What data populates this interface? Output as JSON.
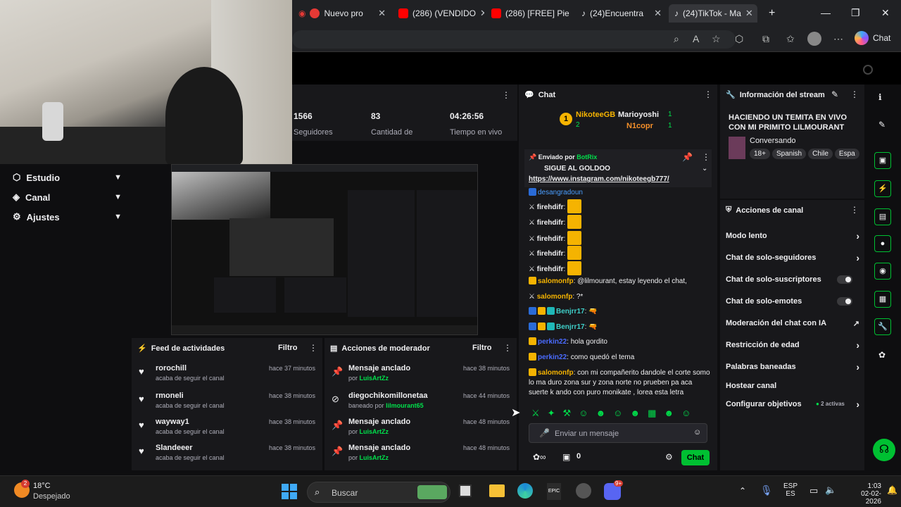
{
  "browser": {
    "tabs": [
      {
        "label": "Nuevo pro",
        "color": "#e53935"
      },
      {
        "label": "(286) (VENDIDO",
        "color": "#ff0000"
      },
      {
        "label": "(286) [FREE] Pie",
        "color": "#ff0000"
      },
      {
        "label": "(24)Encuentra",
        "color": "#000000"
      },
      {
        "label": "(24)TikTok - Ma",
        "color": "#000000"
      }
    ],
    "new_tab": "+",
    "copilot_label": "Chat"
  },
  "nav": [
    {
      "label": "Estudio"
    },
    {
      "label": "Canal"
    },
    {
      "label": "Ajustes"
    }
  ],
  "stats": {
    "followers_value": "1566",
    "followers_label": "Seguidores",
    "count_value": "83",
    "count_label": "Cantidad de",
    "time_value": "04:26:56",
    "time_label": "Tiempo en vivo"
  },
  "feed": {
    "title": "Feed de actividades",
    "filter": "Filtro",
    "items": [
      {
        "name": "rorochill",
        "sub": "acaba de seguir el canal",
        "time": "hace 37 minutos"
      },
      {
        "name": "rmoneli",
        "sub": "acaba de seguir el canal",
        "time": "hace 38 minutos"
      },
      {
        "name": "wayway1",
        "sub": "acaba de seguir el canal",
        "time": "hace 38 minutos"
      },
      {
        "name": "Slandeeer",
        "sub": "acaba de seguir el canal",
        "time": "hace 38 minutos"
      }
    ]
  },
  "mod": {
    "title": "Acciones de moderador",
    "filter": "Filtro",
    "items": [
      {
        "name": "Mensaje anclado",
        "prefix": "por",
        "user": "LuisArtZz",
        "time": "hace 38 minutos"
      },
      {
        "name": "diegochikomillonetaa",
        "prefix": "baneado por",
        "user": "lilmourant65",
        "time": "hace 44 minutos"
      },
      {
        "name": "Mensaje anclado",
        "prefix": "por",
        "user": "LuisArtZz",
        "time": "hace 48 minutos"
      },
      {
        "name": "Mensaje anclado",
        "prefix": "por",
        "user": "LuisArtZz",
        "time": "hace 48 minutos"
      }
    ]
  },
  "chat": {
    "title": "Chat",
    "leaders": [
      {
        "name": "NikoteeGB",
        "count": "2"
      },
      {
        "name": "Marioyoshi",
        "count": "1"
      },
      {
        "name": "N1copr",
        "count": "1"
      }
    ],
    "pinned_by_label": "Enviado por",
    "pinned_by": "BotRix",
    "pinned_text": "SIGUE AL GOLDOO",
    "pinned_link": "https://www.instagram.com/nikoteegb777/",
    "partial_user": "desangradoun",
    "messages": [
      {
        "user": "firehdifr",
        "text": ""
      },
      {
        "user": "firehdifr",
        "text": ""
      },
      {
        "user": "firehdifr",
        "text": ""
      },
      {
        "user": "firehdifr",
        "text": ""
      },
      {
        "user": "firehdifr",
        "text": ""
      },
      {
        "user": "salomonfp",
        "text": ": @lilmourant, estay leyendo el chat,"
      },
      {
        "user": "salomonfp",
        "text": ": ?*"
      },
      {
        "user": "Benjrr17",
        "text": ":"
      },
      {
        "user": "Benjrr17",
        "text": ":"
      },
      {
        "user": "perkin22",
        "text": ": hola gordito"
      },
      {
        "user": "perkin22",
        "text": ": como quedó el tema"
      },
      {
        "user": "salomonfp",
        "text": ": con mi compañerito dandole el corte somo lo ma duro zona sur y zona norte no prueben pa aca suerte k ando con puro monikate , lorea esta letra"
      }
    ],
    "input_placeholder": "Enviar un mensaje",
    "viewers": "0",
    "send_label": "Chat"
  },
  "info": {
    "title": "Información del stream",
    "stream_title": "HACIENDO UN TEMITA EN VIVO CON MI PRIMITO LILMOURANT",
    "category": "Conversando",
    "tags": [
      "18+",
      "Spanish",
      "Chile",
      "Espa"
    ]
  },
  "actions": {
    "title": "Acciones de canal",
    "items": [
      {
        "label": "Modo lento",
        "control": "arrow"
      },
      {
        "label": "Chat de solo-seguidores",
        "control": "arrow"
      },
      {
        "label": "Chat de solo-suscriptores",
        "control": "toggle"
      },
      {
        "label": "Chat de solo-emotes",
        "control": "toggle"
      },
      {
        "label": "Moderación del chat con IA",
        "control": "external"
      },
      {
        "label": "Restricción de edad",
        "control": "arrow"
      },
      {
        "label": "Palabras baneadas",
        "control": "arrow"
      },
      {
        "label": "Hostear canal",
        "control": "none"
      },
      {
        "label": "Configurar objetivos",
        "control": "arrow"
      }
    ],
    "goals_active": "2 activas"
  },
  "taskbar": {
    "weather_temp": "18°C",
    "weather_desc": "Despejado",
    "weather_badge": "2",
    "search_placeholder": "Buscar",
    "lang1": "ESP",
    "lang2": "ES",
    "time": "1:03",
    "date": "02-02-2026",
    "notif_badge": "9+"
  },
  "colors": {
    "accent": "#00e04b",
    "brand": "#00c032",
    "bg": "#0e0e10",
    "panel": "#18181b"
  }
}
